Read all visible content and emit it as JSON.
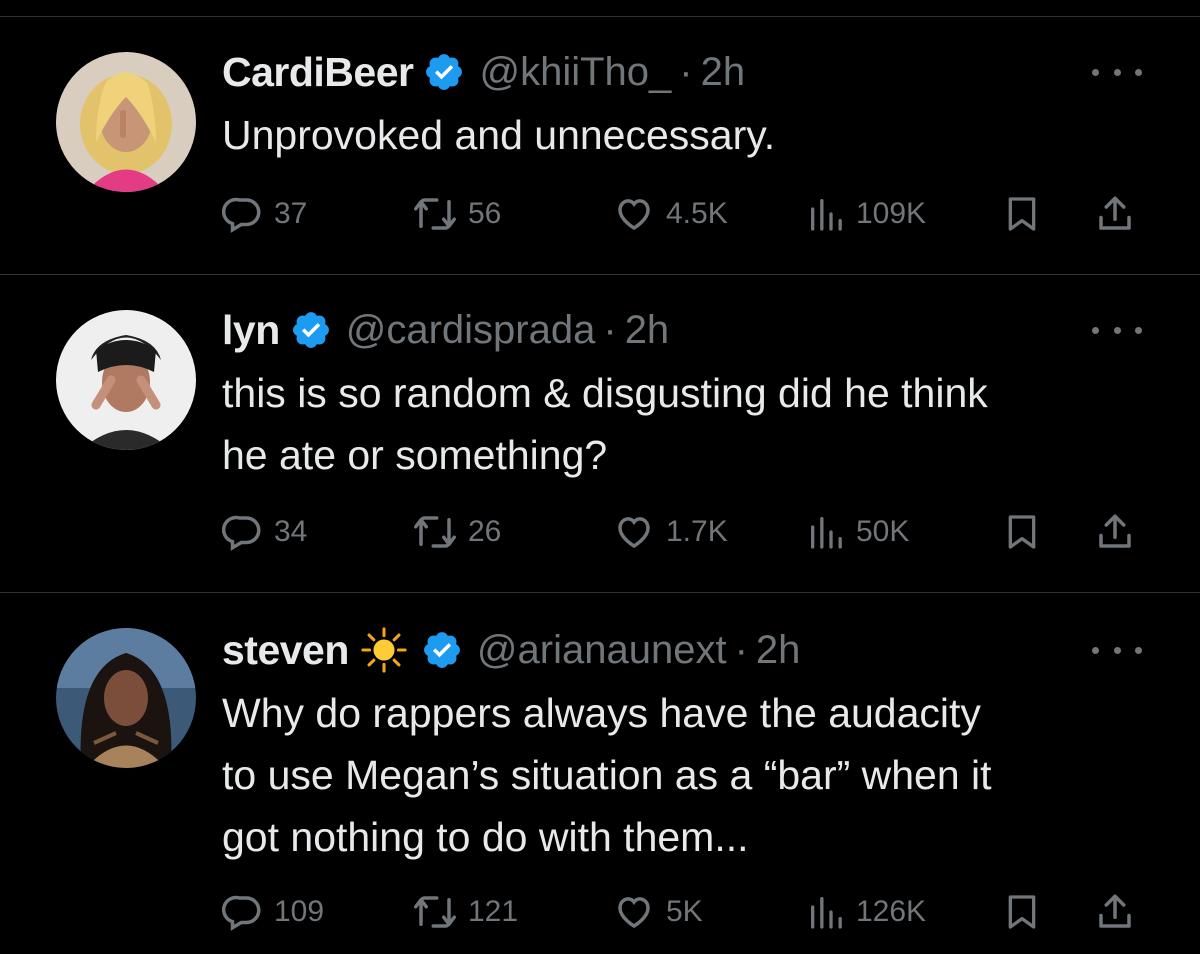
{
  "tweets": [
    {
      "display_name": "CardiBeer",
      "verified": true,
      "emoji": "",
      "handle": "@khiiTho_",
      "separator": "·",
      "time": "2h",
      "text": "Unprovoked and unnecessary.",
      "replies": "37",
      "reposts": "56",
      "likes": "4.5K",
      "views": "109K"
    },
    {
      "display_name": "lyn",
      "verified": true,
      "emoji": "",
      "handle": "@cardisprada",
      "separator": "·",
      "time": "2h",
      "text": "this is so random & disgusting did he think\nhe ate or something?",
      "replies": "34",
      "reposts": "26",
      "likes": "1.7K",
      "views": "50K"
    },
    {
      "display_name": "steven",
      "verified": true,
      "emoji": "sun-emoji",
      "handle": "@arianaunext",
      "separator": "·",
      "time": "2h",
      "text": "Why do rappers always have the audacity\nto use Megan’s situation as a “bar” when it\ngot nothing to do with them...",
      "replies": "109",
      "reposts": "121",
      "likes": "5K",
      "views": "126K"
    }
  ],
  "icons": {
    "reply": "reply-icon",
    "repost": "repost-icon",
    "like": "heart-icon",
    "views": "views-icon",
    "bookmark": "bookmark-icon",
    "share": "share-icon",
    "more": "more-icon",
    "verified": "verified-badge-icon"
  },
  "colors": {
    "background": "#000000",
    "text": "#e7e9ea",
    "muted": "#71767b",
    "verified": "#1d9bf0",
    "divider": "#2f3336"
  }
}
